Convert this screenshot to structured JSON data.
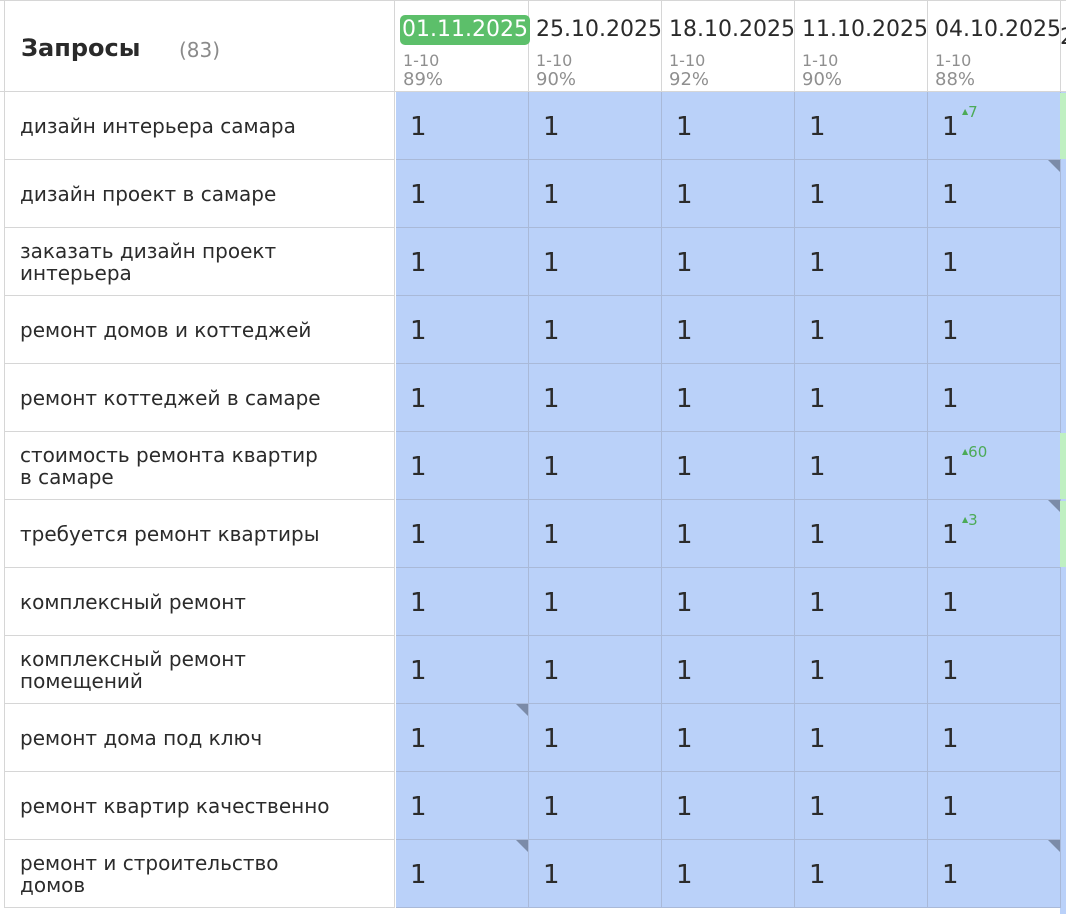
{
  "header": {
    "title": "Запросы",
    "count": "(83)",
    "dates": [
      {
        "date": "01.11.2025",
        "range": "1-10",
        "pct": "89%",
        "active": true
      },
      {
        "date": "25.10.2025",
        "range": "1-10",
        "pct": "90%",
        "active": false
      },
      {
        "date": "18.10.2025",
        "range": "1-10",
        "pct": "92%",
        "active": false
      },
      {
        "date": "11.10.2025",
        "range": "1-10",
        "pct": "90%",
        "active": false
      },
      {
        "date": "04.10.2025",
        "range": "1-10",
        "pct": "88%",
        "active": false
      }
    ]
  },
  "colors": {
    "active_date_bg": "#5cbf6a",
    "cell_bg": "#bad1f9",
    "delta_up": "#4caa57",
    "corner_mark": "#7b8ba8"
  },
  "rows": [
    {
      "query": "дизайн интерьера самара",
      "values": [
        "1",
        "1",
        "1",
        "1",
        "1"
      ],
      "delta": {
        "col": 4,
        "text": "7"
      },
      "corners": [],
      "edge_green": true
    },
    {
      "query": "дизайн проект в самаре",
      "values": [
        "1",
        "1",
        "1",
        "1",
        "1"
      ],
      "delta": null,
      "corners": [
        4
      ],
      "edge_green": false
    },
    {
      "query": "заказать дизайн проект интерьера",
      "values": [
        "1",
        "1",
        "1",
        "1",
        "1"
      ],
      "delta": null,
      "corners": [],
      "edge_green": false
    },
    {
      "query": "ремонт домов и коттеджей",
      "values": [
        "1",
        "1",
        "1",
        "1",
        "1"
      ],
      "delta": null,
      "corners": [],
      "edge_green": false
    },
    {
      "query": "ремонт коттеджей в самаре",
      "values": [
        "1",
        "1",
        "1",
        "1",
        "1"
      ],
      "delta": null,
      "corners": [],
      "edge_green": false
    },
    {
      "query": "стоимость ремонта квартир в самаре",
      "values": [
        "1",
        "1",
        "1",
        "1",
        "1"
      ],
      "delta": {
        "col": 4,
        "text": "60"
      },
      "corners": [],
      "edge_green": true
    },
    {
      "query": "требуется ремонт квартиры",
      "values": [
        "1",
        "1",
        "1",
        "1",
        "1"
      ],
      "delta": {
        "col": 4,
        "text": "3"
      },
      "corners": [
        4
      ],
      "edge_green": true
    },
    {
      "query": "комплексный ремонт",
      "values": [
        "1",
        "1",
        "1",
        "1",
        "1"
      ],
      "delta": null,
      "corners": [],
      "edge_green": false
    },
    {
      "query": "комплексный ремонт помещений",
      "values": [
        "1",
        "1",
        "1",
        "1",
        "1"
      ],
      "delta": null,
      "corners": [],
      "edge_green": false
    },
    {
      "query": "ремонт дома под ключ",
      "values": [
        "1",
        "1",
        "1",
        "1",
        "1"
      ],
      "delta": null,
      "corners": [
        0
      ],
      "edge_green": false
    },
    {
      "query": "ремонт квартир качественно",
      "values": [
        "1",
        "1",
        "1",
        "1",
        "1"
      ],
      "delta": null,
      "corners": [],
      "edge_green": false
    },
    {
      "query": "ремонт и строительство домов",
      "values": [
        "1",
        "1",
        "1",
        "1",
        "1"
      ],
      "delta": null,
      "corners": [
        0,
        4
      ],
      "edge_green": false
    }
  ]
}
